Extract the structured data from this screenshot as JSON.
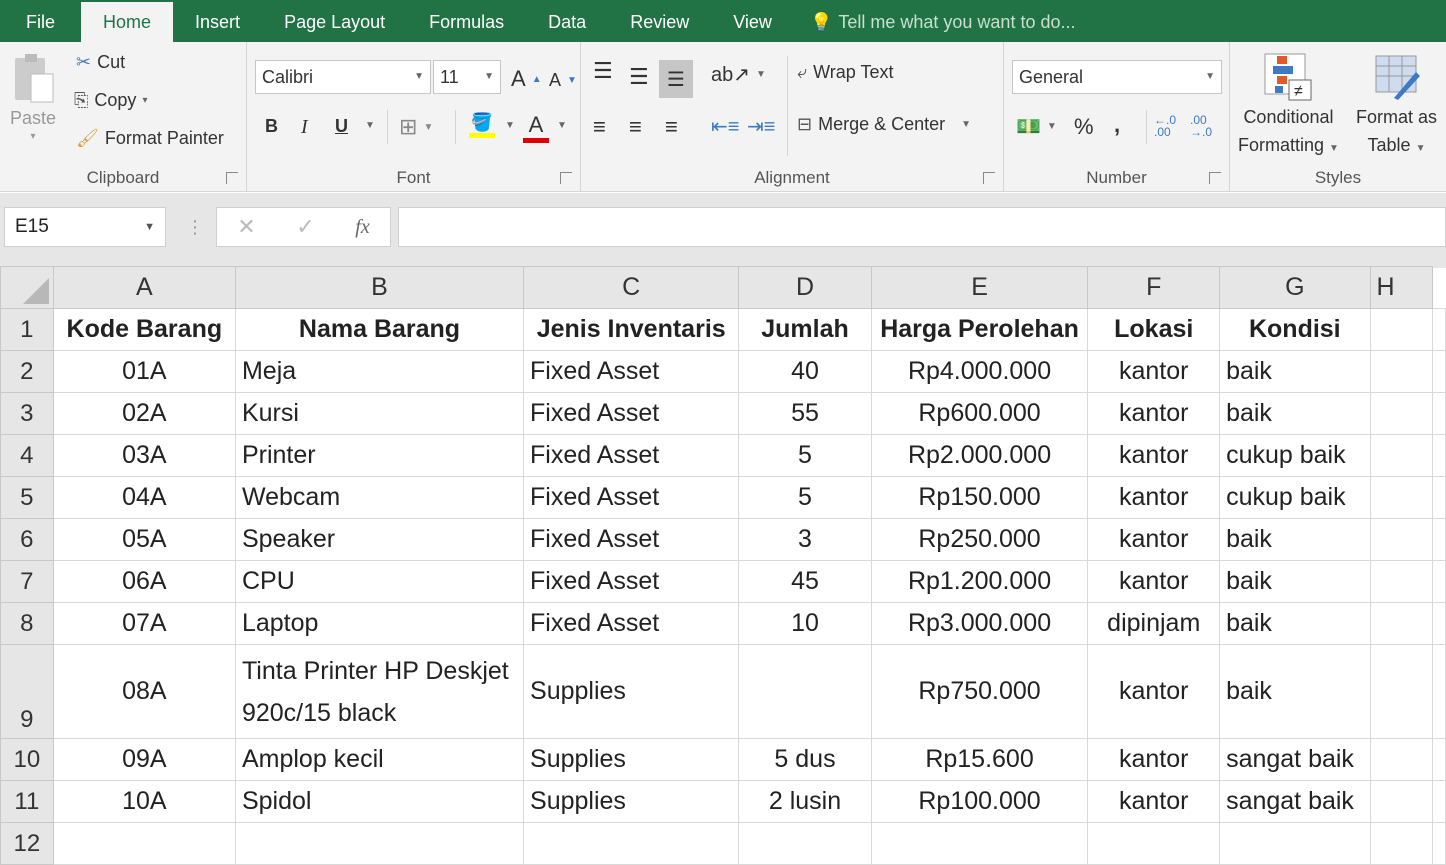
{
  "tabs": [
    "File",
    "Home",
    "Insert",
    "Page Layout",
    "Formulas",
    "Data",
    "Review",
    "View"
  ],
  "active_tab": "Home",
  "tell_me": "Tell me what you want to do...",
  "clipboard": {
    "paste": "Paste",
    "cut": "Cut",
    "copy": "Copy",
    "format_painter": "Format Painter",
    "label": "Clipboard"
  },
  "font": {
    "name": "Calibri",
    "size": "11",
    "label": "Font",
    "bold": "B",
    "italic": "I",
    "underline": "U",
    "grow": "A",
    "shrink": "A",
    "font_color": "A"
  },
  "alignment": {
    "wrap_text": "Wrap Text",
    "merge_center": "Merge & Center",
    "label": "Alignment"
  },
  "number": {
    "format": "General",
    "percent": "%",
    "comma": ",",
    "label": "Number",
    "inc_decimal": "←.0 .00",
    "dec_decimal": ".00 →.0"
  },
  "styles": {
    "conditional_1": "Conditional",
    "conditional_2": "Formatting",
    "format_as_1": "Format as",
    "format_as_2": "Table",
    "label": "Styles"
  },
  "formula_bar": {
    "name_box": "E15",
    "cancel": "✕",
    "enter": "✓",
    "fx": "fx",
    "value": ""
  },
  "columns": [
    "A",
    "B",
    "C",
    "D",
    "E",
    "F",
    "G",
    "H"
  ],
  "rows": [
    {
      "n": "1",
      "cells": [
        "Kode Barang",
        "Nama Barang",
        "Jenis Inventaris",
        "Jumlah",
        "Harga Perolehan",
        "Lokasi",
        "Kondisi",
        ""
      ]
    },
    {
      "n": "2",
      "cells": [
        "01A",
        "Meja",
        "Fixed Asset",
        "40",
        "Rp4.000.000",
        "kantor",
        "baik",
        ""
      ]
    },
    {
      "n": "3",
      "cells": [
        "02A",
        "Kursi",
        "Fixed Asset",
        "55",
        "Rp600.000",
        "kantor",
        "baik",
        ""
      ]
    },
    {
      "n": "4",
      "cells": [
        "03A",
        "Printer",
        "Fixed Asset",
        "5",
        "Rp2.000.000",
        "kantor",
        "cukup baik",
        ""
      ]
    },
    {
      "n": "5",
      "cells": [
        "04A",
        "Webcam",
        "Fixed Asset",
        "5",
        "Rp150.000",
        "kantor",
        "cukup baik",
        ""
      ]
    },
    {
      "n": "6",
      "cells": [
        "05A",
        "Speaker",
        "Fixed Asset",
        "3",
        "Rp250.000",
        "kantor",
        "baik",
        ""
      ]
    },
    {
      "n": "7",
      "cells": [
        "06A",
        "CPU",
        "Fixed Asset",
        "45",
        "Rp1.200.000",
        "kantor",
        "baik",
        ""
      ]
    },
    {
      "n": "8",
      "cells": [
        "07A",
        "Laptop",
        "Fixed Asset",
        "10",
        "Rp3.000.000",
        "dipinjam",
        "baik",
        ""
      ]
    },
    {
      "n": "9",
      "cells": [
        "08A",
        "Tinta Printer HP Deskjet 920c/15 black",
        "Supplies",
        "",
        "Rp750.000",
        "kantor",
        "baik",
        ""
      ]
    },
    {
      "n": "10",
      "cells": [
        "09A",
        "Amplop kecil",
        "Supplies",
        "5 dus",
        "Rp15.600",
        "kantor",
        "sangat baik",
        ""
      ]
    },
    {
      "n": "11",
      "cells": [
        "10A",
        "Spidol",
        "Supplies",
        "2 lusin",
        "Rp100.000",
        "kantor",
        "sangat baik",
        ""
      ]
    },
    {
      "n": "12",
      "cells": [
        "",
        "",
        "",
        "",
        "",
        "",
        "",
        ""
      ]
    }
  ]
}
